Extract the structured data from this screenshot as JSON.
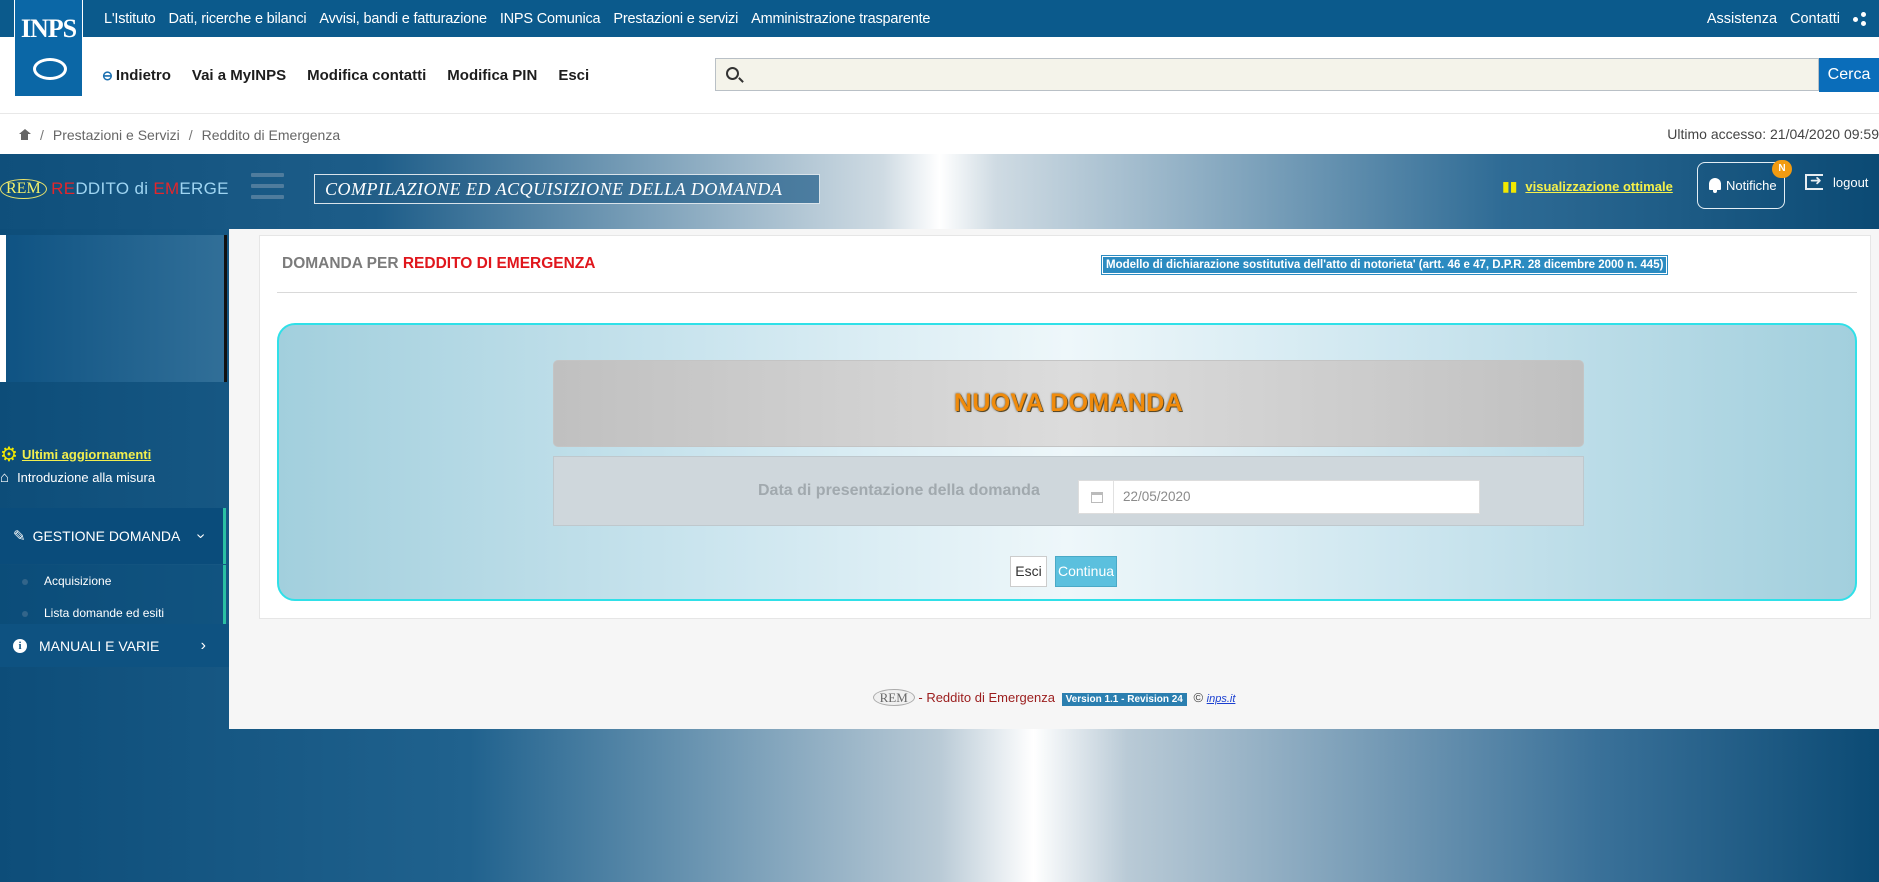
{
  "topbar": {
    "logo_text": "INPS",
    "nav": [
      "L'Istituto",
      "Dati, ricerche e bilanci",
      "Avvisi, bandi e fatturazione",
      "INPS Comunica",
      "Prestazioni e servizi",
      "Amministrazione trasparente"
    ],
    "right": [
      "Assistenza",
      "Contatti"
    ]
  },
  "secbar": {
    "back_label": "Indietro",
    "nav": [
      "Vai a MyINPS",
      "Modifica contatti",
      "Modifica PIN",
      "Esci"
    ],
    "search_placeholder": "",
    "search_button": "Cerca"
  },
  "breadcrumb": {
    "items": [
      "Prestazioni e Servizi",
      "Reddito di Emergenza"
    ],
    "last_access": "Ultimo accesso: 21/04/2020 09:59"
  },
  "banner": {
    "rem_badge": "REM",
    "title_parts": [
      "RE",
      "DDITO di ",
      "EM",
      "ERGENZA"
    ],
    "section_title": "COMPILAZIONE ED ACQUISIZIONE DELLA DOMANDA",
    "viz_label": "visualizzazione ottimale",
    "notif_label": "Notifiche",
    "notif_badge": "N",
    "logout_label": "logout"
  },
  "sidebar": {
    "updates": "Ultimi aggiornamenti",
    "intro": "Introduzione alla misura",
    "gestione": "GESTIONE DOMANDA",
    "sub_items": [
      "Acquisizione",
      "Lista domande ed esiti"
    ],
    "manuali": "MANUALI E VARIE"
  },
  "main": {
    "title_prefix": "DOMANDA PER ",
    "title_highlight": "REDDITO DI EMERGENZA",
    "modello": "Modello di dichiarazione sostitutiva dell'atto di notorieta' (artt. 46 e 47, D.P.R. 28 dicembre 2000 n. 445)",
    "nuova_domanda": "NUOVA DOMANDA",
    "date_label": "Data di presentazione della domanda",
    "date_value": "22/05/2020",
    "btn_esci": "Esci",
    "btn_continua": "Continua"
  },
  "footer": {
    "badge": "REM",
    "text": " - Reddito di Emergenza ",
    "version": "Version 1.1 - Revision 24",
    "copy": " © ",
    "link": "inps.it"
  }
}
